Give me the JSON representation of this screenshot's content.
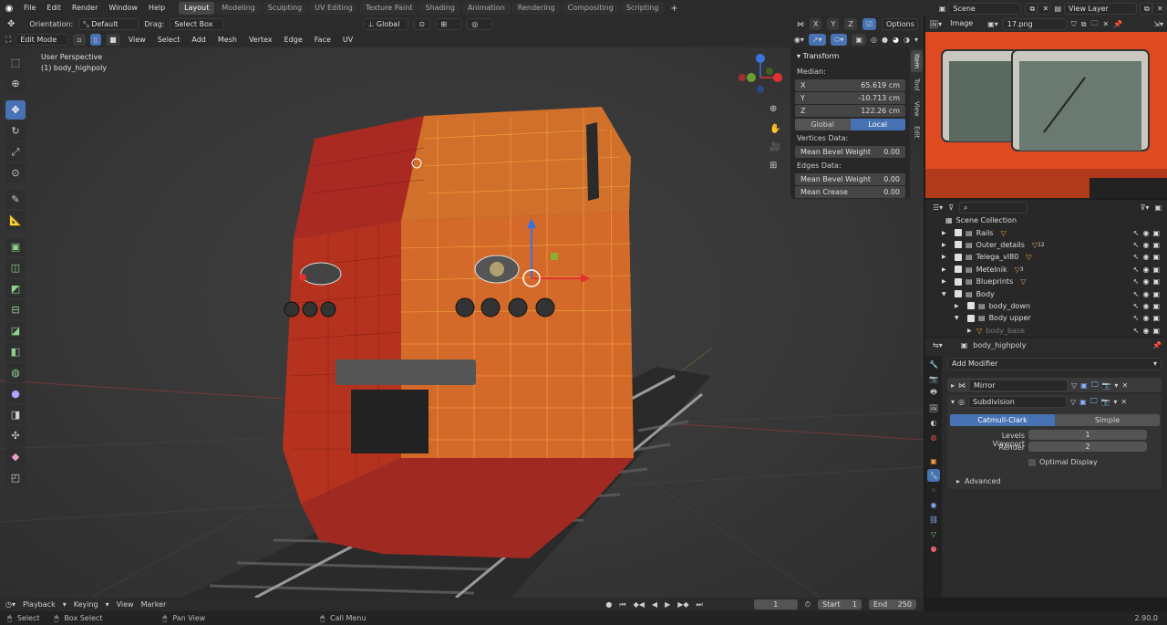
{
  "topbar": {
    "menus": [
      "File",
      "Edit",
      "Render",
      "Window",
      "Help"
    ],
    "workspaces": [
      "Layout",
      "Modeling",
      "Sculpting",
      "UV Editing",
      "Texture Paint",
      "Shading",
      "Animation",
      "Rendering",
      "Compositing",
      "Scripting"
    ],
    "active_workspace": "Layout",
    "add_tab": "+",
    "scene": "Scene",
    "view_layer": "View Layer"
  },
  "header1": {
    "orientation_label": "Orientation:",
    "orientation_value": "Default",
    "drag_label": "Drag:",
    "drag_value": "Select Box",
    "transform_space": "Global",
    "axes": [
      "X",
      "Y",
      "Z"
    ],
    "options": "Options"
  },
  "header2": {
    "mode": "Edit Mode",
    "menus": [
      "View",
      "Select",
      "Add",
      "Mesh",
      "Vertex",
      "Edge",
      "Face",
      "UV"
    ]
  },
  "viewport": {
    "perspective": "User Perspective",
    "object": "(1) body_highpoly"
  },
  "npanel": {
    "section": "Transform",
    "median_label": "Median:",
    "x_label": "X",
    "x_value": "65.619 cm",
    "y_label": "Y",
    "y_value": "-10.713 cm",
    "z_label": "Z",
    "z_value": "122.26 cm",
    "global_btn": "Global",
    "local_btn": "Local",
    "vertices_data": "Vertices Data:",
    "mean_bevel_weight_v": "Mean Bevel Weight",
    "mbw_v_value": "0.00",
    "edges_data": "Edges Data:",
    "mean_bevel_weight_e": "Mean Bevel Weight",
    "mbw_e_value": "0.00",
    "mean_crease": "Mean Crease",
    "crease_value": "0.00",
    "tabs": [
      "Item",
      "Tool",
      "View",
      "Edit"
    ]
  },
  "image_editor": {
    "mode": "Image",
    "image_name": "17.png"
  },
  "outliner": {
    "root": "Scene Collection",
    "items": [
      {
        "name": "Rails",
        "indent": 0,
        "badge": ""
      },
      {
        "name": "Outer_details",
        "indent": 0,
        "badge": "12"
      },
      {
        "name": "Telega_vl80",
        "indent": 0,
        "badge": ""
      },
      {
        "name": "Metelnik",
        "indent": 0,
        "badge": "3"
      },
      {
        "name": "Blueprints",
        "indent": 0,
        "badge": ""
      },
      {
        "name": "Body",
        "indent": 0,
        "badge": ""
      },
      {
        "name": "body_down",
        "indent": 1,
        "badge": ""
      },
      {
        "name": "Body upper",
        "indent": 1,
        "badge": ""
      },
      {
        "name": "body_base",
        "indent": 2,
        "badge": ""
      }
    ]
  },
  "properties": {
    "object_name": "body_highpoly",
    "add_modifier": "Add Modifier",
    "modifiers": [
      "Mirror",
      "Subdivision"
    ],
    "catmull": "Catmull-Clark",
    "simple": "Simple",
    "levels_viewport_label": "Levels Viewport",
    "levels_viewport": "1",
    "render_label": "Render",
    "render": "2",
    "optimal_display": "Optimal Display",
    "advanced": "Advanced"
  },
  "timeline": {
    "menus": [
      "Playback",
      "Keying",
      "View",
      "Marker"
    ],
    "current_frame": "1",
    "start_label": "Start",
    "start": "1",
    "end_label": "End",
    "end": "250"
  },
  "status": {
    "select": "Select",
    "box_select": "Box Select",
    "pan_view": "Pan View",
    "call_menu": "Call Menu",
    "version": "2.90.0"
  },
  "colors": {
    "accent": "#4772b3",
    "header": "#2b2b2b",
    "viewport": "#393939",
    "train_red": "#c0392b",
    "selected_orange": "#e8a040"
  }
}
